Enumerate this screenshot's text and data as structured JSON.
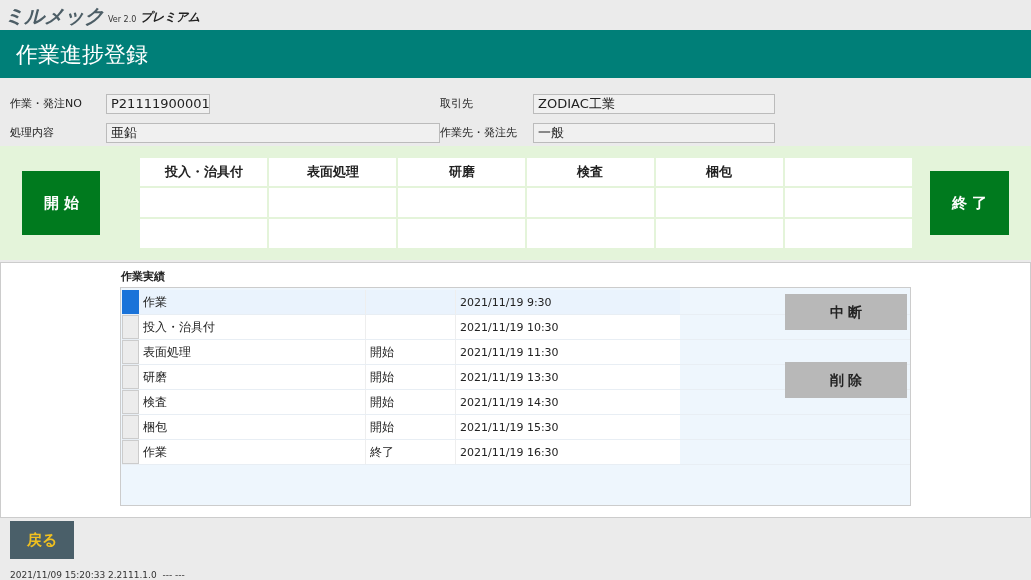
{
  "logo": {
    "brand": "ミルメック",
    "version": "Ver 2.0",
    "edition": "プレミアム"
  },
  "title": "作業進捗登録",
  "form": {
    "order_no": {
      "label": "作業・発注NO",
      "value": "P21111900001"
    },
    "process": {
      "label": "処理内容",
      "value": "亜鉛"
    },
    "client": {
      "label": "取引先",
      "value": "ZODIAC工業"
    },
    "contractor": {
      "label": "作業先・発注先",
      "value": "一般"
    }
  },
  "start_button": "開 始",
  "end_button": "終 了",
  "stages": {
    "columns": [
      "投入・治具付",
      "表面処理",
      "研磨",
      "検査",
      "梱包",
      ""
    ]
  },
  "results": {
    "label": "作業実績",
    "rows": [
      {
        "name": "作業",
        "status": "",
        "time": "2021/11/19 9:30",
        "selected": true
      },
      {
        "name": "投入・治具付",
        "status": "",
        "time": "2021/11/19 10:30",
        "selected": false
      },
      {
        "name": "表面処理",
        "status": "開始",
        "time": "2021/11/19 11:30",
        "selected": false
      },
      {
        "name": "研磨",
        "status": "開始",
        "time": "2021/11/19 13:30",
        "selected": false
      },
      {
        "name": "検査",
        "status": "開始",
        "time": "2021/11/19 14:30",
        "selected": false
      },
      {
        "name": "梱包",
        "status": "開始",
        "time": "2021/11/19 15:30",
        "selected": false
      },
      {
        "name": "作業",
        "status": "終了",
        "time": "2021/11/19 16:30",
        "selected": false
      }
    ]
  },
  "side_buttons": [
    "中 断",
    "削 除"
  ],
  "back_button": "戻る",
  "status_bar": "2021/11/09 15:20:33 2.2111.1.0  --- ---"
}
